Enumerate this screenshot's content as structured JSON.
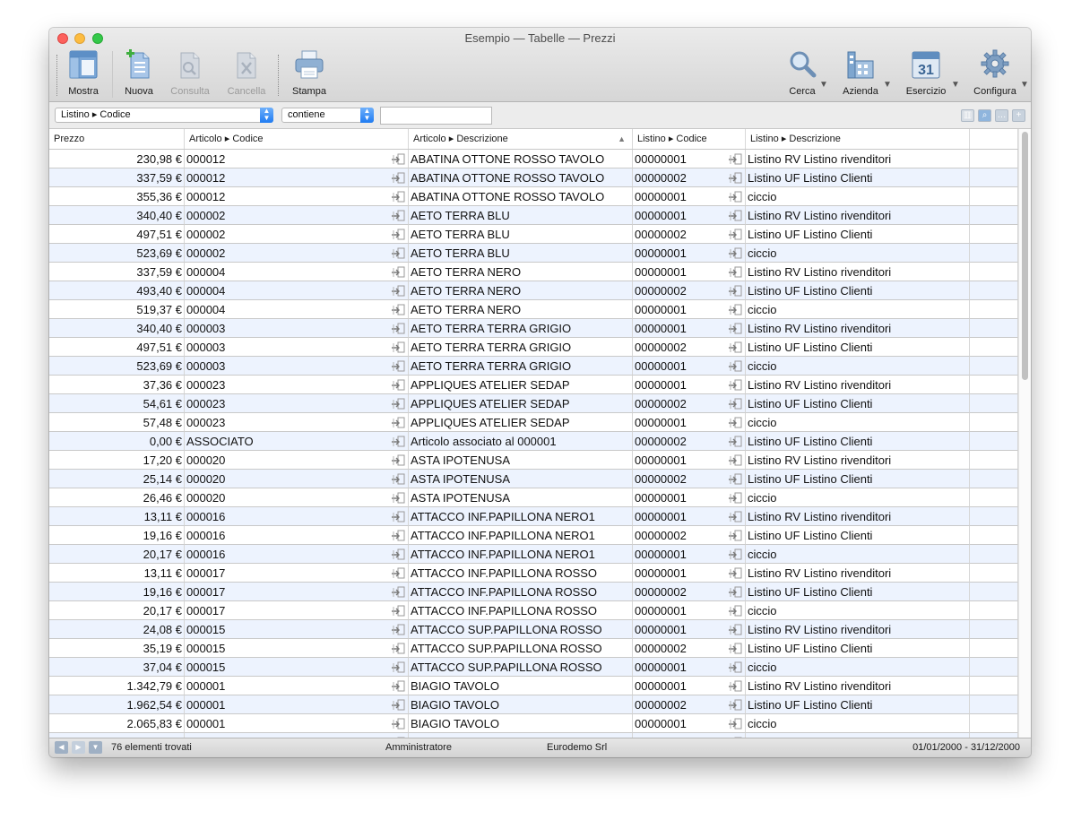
{
  "window": {
    "title": "Esempio — Tabelle — Prezzi"
  },
  "toolbar": {
    "mostra": "Mostra",
    "nuova": "Nuova",
    "consulta": "Consulta",
    "cancella": "Cancella",
    "stampa": "Stampa",
    "cerca": "Cerca",
    "azienda": "Azienda",
    "esercizio": "Esercizio",
    "esercizio_day": "31",
    "configura": "Configura"
  },
  "filter": {
    "field": "Listino ▸ Codice",
    "operator": "contiene",
    "value": ""
  },
  "columns": {
    "prezzo": "Prezzo",
    "articolo_codice": "Articolo ▸ Codice",
    "articolo_descrizione": "Articolo ▸ Descrizione",
    "listino_codice": "Listino ▸ Codice",
    "listino_descrizione": "Listino ▸ Descrizione"
  },
  "rows": [
    {
      "prezzo": "230,98 €",
      "art_cod": "000012",
      "art_desc": "ABATINA OTTONE ROSSO TAVOLO",
      "list_cod": "00000001",
      "list_desc": "Listino RV Listino rivenditori"
    },
    {
      "prezzo": "337,59 €",
      "art_cod": "000012",
      "art_desc": "ABATINA OTTONE ROSSO TAVOLO",
      "list_cod": "00000002",
      "list_desc": "Listino UF Listino Clienti"
    },
    {
      "prezzo": "355,36 €",
      "art_cod": "000012",
      "art_desc": "ABATINA OTTONE ROSSO TAVOLO",
      "list_cod": "00000001",
      "list_desc": "ciccio"
    },
    {
      "prezzo": "340,40 €",
      "art_cod": "000002",
      "art_desc": "AETO TERRA BLU",
      "list_cod": "00000001",
      "list_desc": "Listino RV Listino rivenditori"
    },
    {
      "prezzo": "497,51 €",
      "art_cod": "000002",
      "art_desc": "AETO TERRA BLU",
      "list_cod": "00000002",
      "list_desc": "Listino UF Listino Clienti"
    },
    {
      "prezzo": "523,69 €",
      "art_cod": "000002",
      "art_desc": "AETO TERRA BLU",
      "list_cod": "00000001",
      "list_desc": "ciccio"
    },
    {
      "prezzo": "337,59 €",
      "art_cod": "000004",
      "art_desc": "AETO TERRA NERO",
      "list_cod": "00000001",
      "list_desc": "Listino RV Listino rivenditori"
    },
    {
      "prezzo": "493,40 €",
      "art_cod": "000004",
      "art_desc": "AETO TERRA NERO",
      "list_cod": "00000002",
      "list_desc": "Listino UF Listino Clienti"
    },
    {
      "prezzo": "519,37 €",
      "art_cod": "000004",
      "art_desc": "AETO TERRA NERO",
      "list_cod": "00000001",
      "list_desc": "ciccio"
    },
    {
      "prezzo": "340,40 €",
      "art_cod": "000003",
      "art_desc": "AETO TERRA TERRA GRIGIO",
      "list_cod": "00000001",
      "list_desc": "Listino RV Listino rivenditori"
    },
    {
      "prezzo": "497,51 €",
      "art_cod": "000003",
      "art_desc": "AETO TERRA TERRA GRIGIO",
      "list_cod": "00000002",
      "list_desc": "Listino UF Listino Clienti"
    },
    {
      "prezzo": "523,69 €",
      "art_cod": "000003",
      "art_desc": "AETO TERRA TERRA GRIGIO",
      "list_cod": "00000001",
      "list_desc": "ciccio"
    },
    {
      "prezzo": "37,36 €",
      "art_cod": "000023",
      "art_desc": "APPLIQUES ATELIER SEDAP",
      "list_cod": "00000001",
      "list_desc": "Listino RV Listino rivenditori"
    },
    {
      "prezzo": "54,61 €",
      "art_cod": "000023",
      "art_desc": "APPLIQUES ATELIER SEDAP",
      "list_cod": "00000002",
      "list_desc": "Listino UF Listino Clienti"
    },
    {
      "prezzo": "57,48 €",
      "art_cod": "000023",
      "art_desc": "APPLIQUES ATELIER SEDAP",
      "list_cod": "00000001",
      "list_desc": "ciccio"
    },
    {
      "prezzo": "0,00 €",
      "art_cod": "ASSOCIATO",
      "art_desc": "Articolo associato al 000001",
      "list_cod": "00000002",
      "list_desc": "Listino UF Listino Clienti"
    },
    {
      "prezzo": "17,20 €",
      "art_cod": "000020",
      "art_desc": "ASTA IPOTENUSA",
      "list_cod": "00000001",
      "list_desc": "Listino RV Listino rivenditori"
    },
    {
      "prezzo": "25,14 €",
      "art_cod": "000020",
      "art_desc": "ASTA IPOTENUSA",
      "list_cod": "00000002",
      "list_desc": "Listino UF Listino Clienti"
    },
    {
      "prezzo": "26,46 €",
      "art_cod": "000020",
      "art_desc": "ASTA IPOTENUSA",
      "list_cod": "00000001",
      "list_desc": "ciccio"
    },
    {
      "prezzo": "13,11 €",
      "art_cod": "000016",
      "art_desc": "ATTACCO INF.PAPILLONA NERO1",
      "list_cod": "00000001",
      "list_desc": "Listino RV Listino rivenditori"
    },
    {
      "prezzo": "19,16 €",
      "art_cod": "000016",
      "art_desc": "ATTACCO INF.PAPILLONA NERO1",
      "list_cod": "00000002",
      "list_desc": "Listino UF Listino Clienti"
    },
    {
      "prezzo": "20,17 €",
      "art_cod": "000016",
      "art_desc": "ATTACCO INF.PAPILLONA NERO1",
      "list_cod": "00000001",
      "list_desc": "ciccio"
    },
    {
      "prezzo": "13,11 €",
      "art_cod": "000017",
      "art_desc": "ATTACCO INF.PAPILLONA ROSSO",
      "list_cod": "00000001",
      "list_desc": "Listino RV Listino rivenditori"
    },
    {
      "prezzo": "19,16 €",
      "art_cod": "000017",
      "art_desc": "ATTACCO INF.PAPILLONA ROSSO",
      "list_cod": "00000002",
      "list_desc": "Listino UF Listino Clienti"
    },
    {
      "prezzo": "20,17 €",
      "art_cod": "000017",
      "art_desc": "ATTACCO INF.PAPILLONA ROSSO",
      "list_cod": "00000001",
      "list_desc": "ciccio"
    },
    {
      "prezzo": "24,08 €",
      "art_cod": "000015",
      "art_desc": "ATTACCO SUP.PAPILLONA ROSSO",
      "list_cod": "00000001",
      "list_desc": "Listino RV Listino rivenditori"
    },
    {
      "prezzo": "35,19 €",
      "art_cod": "000015",
      "art_desc": "ATTACCO SUP.PAPILLONA ROSSO",
      "list_cod": "00000002",
      "list_desc": "Listino UF Listino Clienti"
    },
    {
      "prezzo": "37,04 €",
      "art_cod": "000015",
      "art_desc": "ATTACCO SUP.PAPILLONA ROSSO",
      "list_cod": "00000001",
      "list_desc": "ciccio"
    },
    {
      "prezzo": "1.342,79 €",
      "art_cod": "000001",
      "art_desc": "BIAGIO TAVOLO",
      "list_cod": "00000001",
      "list_desc": "Listino RV Listino rivenditori"
    },
    {
      "prezzo": "1.962,54 €",
      "art_cod": "000001",
      "art_desc": "BIAGIO TAVOLO",
      "list_cod": "00000002",
      "list_desc": "Listino UF Listino Clienti"
    },
    {
      "prezzo": "2.065,83 €",
      "art_cod": "000001",
      "art_desc": "BIAGIO TAVOLO",
      "list_cod": "00000001",
      "list_desc": "ciccio"
    },
    {
      "prezzo": "",
      "art_cod": "",
      "art_desc": "",
      "list_cod": "",
      "list_desc": ""
    }
  ],
  "status": {
    "count": "76 elementi trovati",
    "user": "Amministratore",
    "company": "Eurodemo Srl",
    "period": "01/01/2000 - 31/12/2000"
  },
  "colors": {
    "row_alt": "#edf3fe",
    "accent": "#1f7bf2"
  }
}
